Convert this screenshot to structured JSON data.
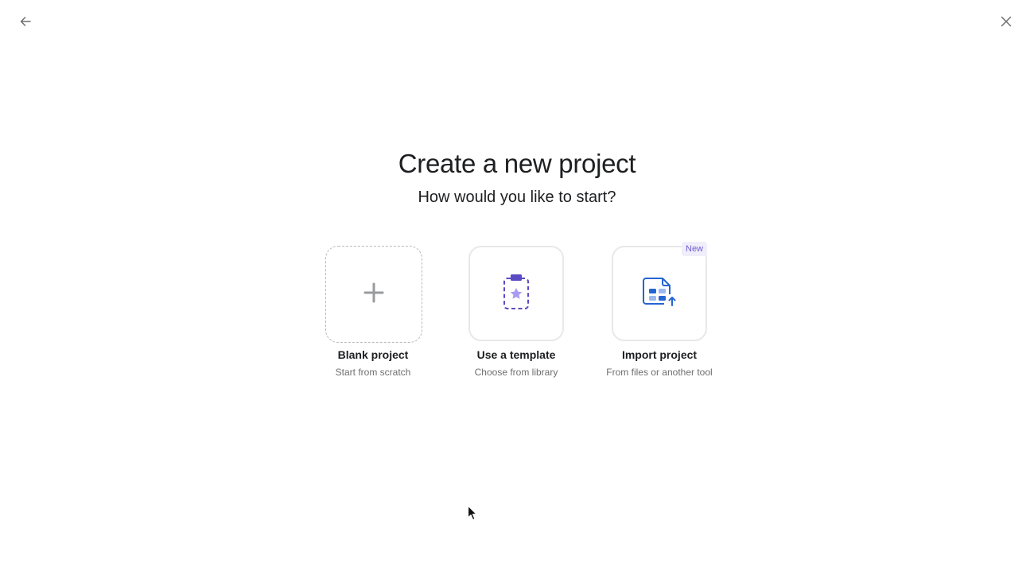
{
  "header": {
    "back_icon": "arrow-left-icon",
    "close_icon": "close-icon"
  },
  "main": {
    "title": "Create a new project",
    "subtitle": "How would you like to start?"
  },
  "options": [
    {
      "title": "Blank project",
      "description": "Start from scratch",
      "icon": "plus-icon"
    },
    {
      "title": "Use a template",
      "description": "Choose from library",
      "icon": "template-star-icon"
    },
    {
      "title": "Import project",
      "description": "From files or another tool",
      "icon": "import-file-icon",
      "badge": "New"
    }
  ],
  "colors": {
    "accent_purple": "#5b4bc4",
    "light_purple": "#a99cf0",
    "accent_blue": "#2664d1",
    "light_blue": "#9bb7ee",
    "badge_bg": "#f0eefa",
    "badge_text": "#6d5bd0",
    "muted_text": "#6d6e6f"
  }
}
